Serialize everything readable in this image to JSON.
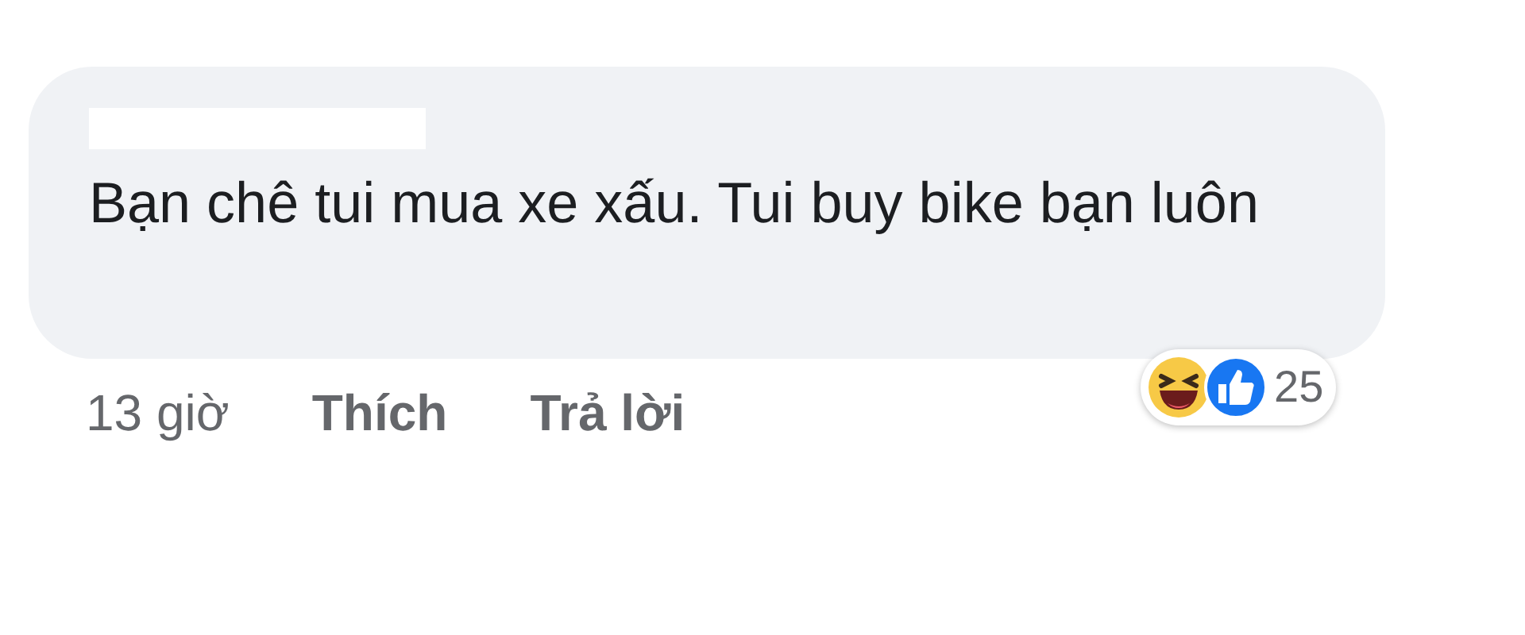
{
  "comment": {
    "text": "Bạn chê tui mua xe xấu. Tui buy bike bạn luôn",
    "time": "13 giờ",
    "actions": [
      "Thích",
      "Trả lời"
    ],
    "reactions": {
      "icons": [
        {
          "kind": "haha"
        },
        {
          "kind": "like"
        }
      ],
      "count": "25"
    }
  }
}
